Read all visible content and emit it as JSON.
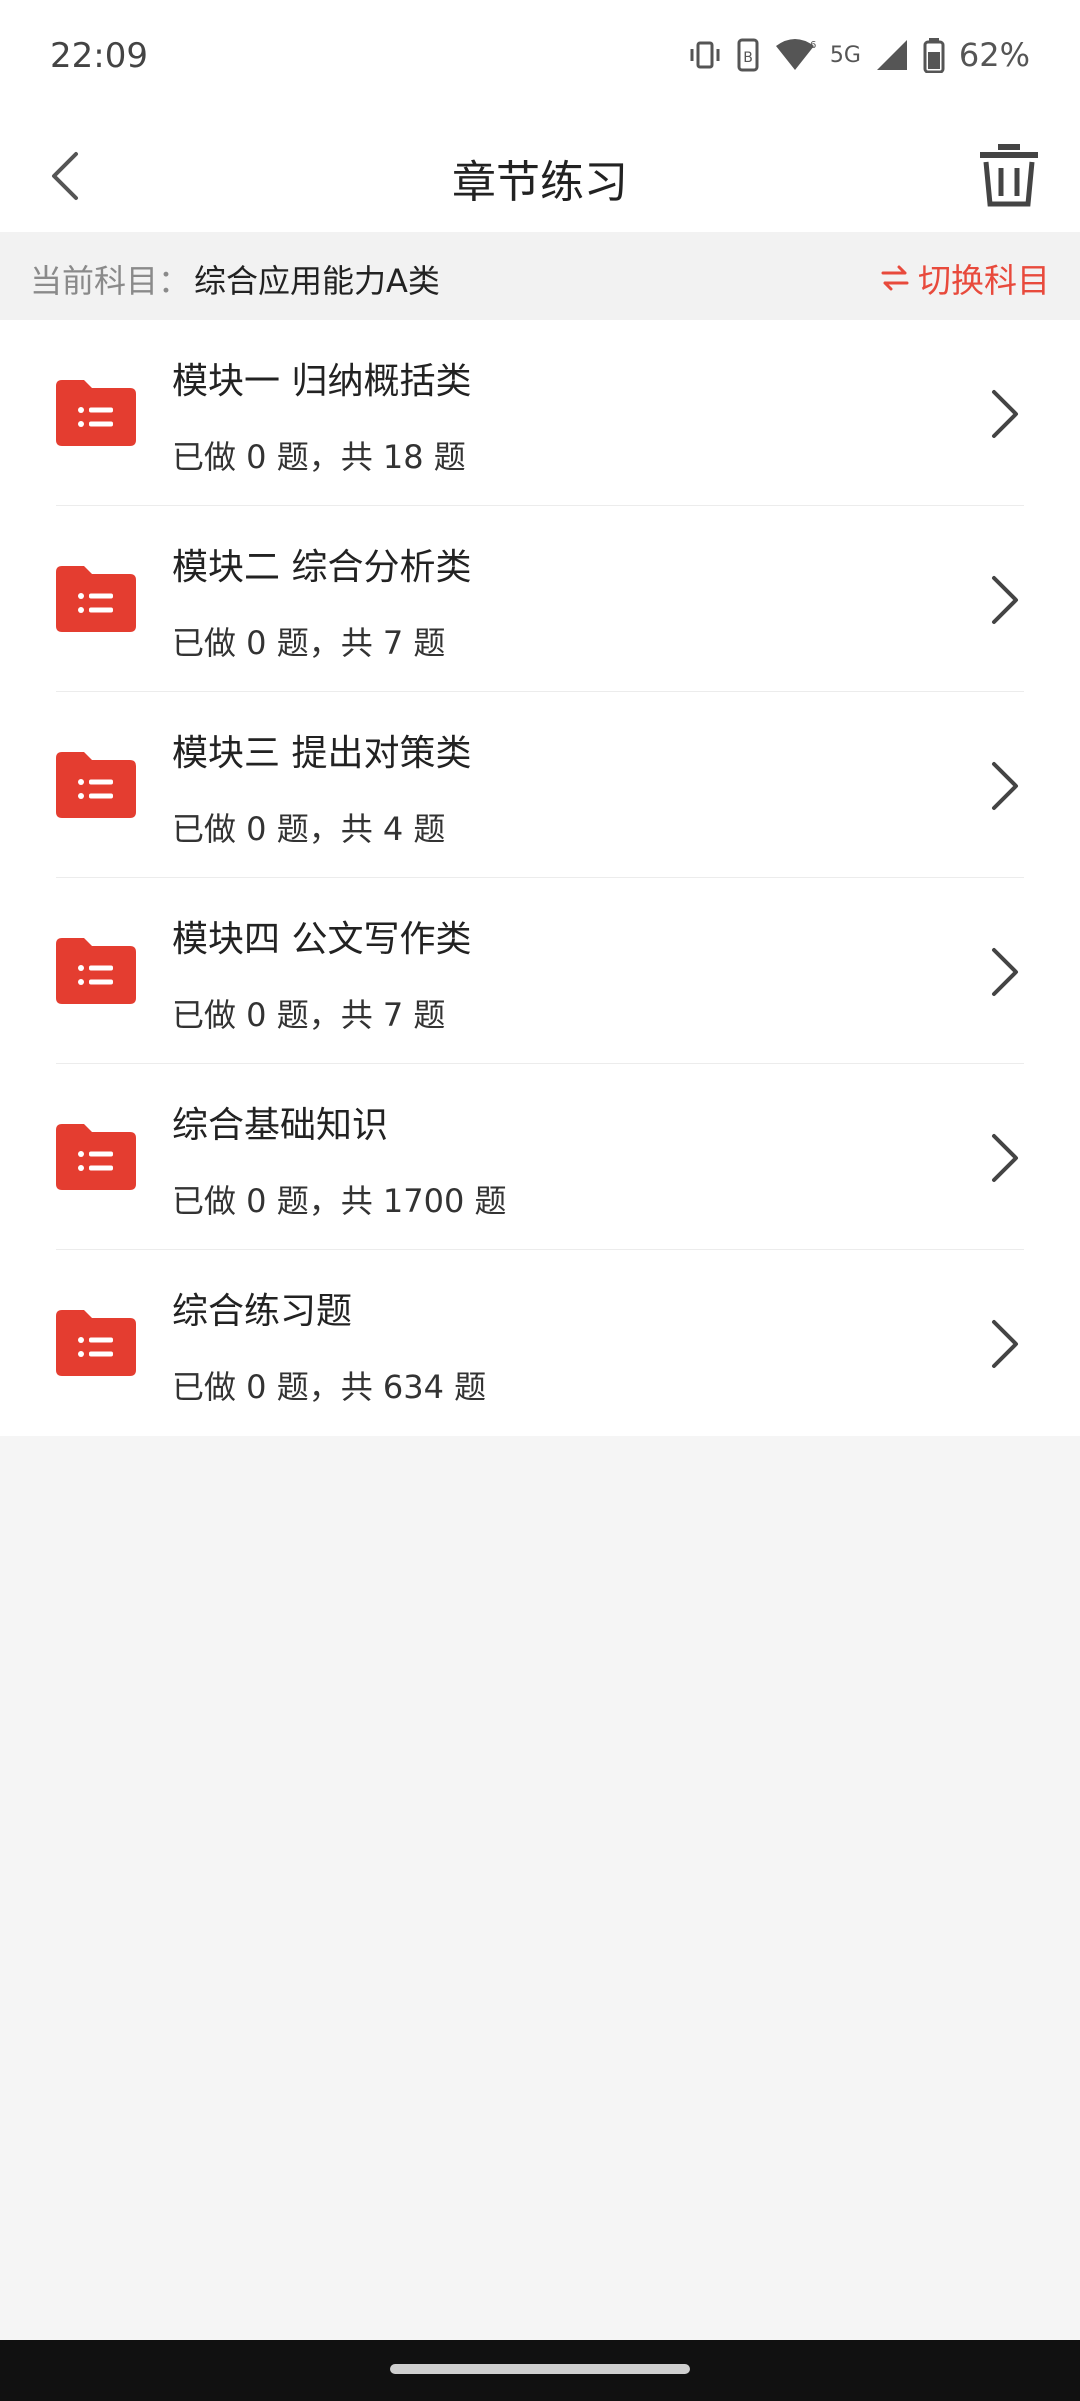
{
  "status_bar": {
    "time": "22:09",
    "network": "5G",
    "battery": "62%"
  },
  "header": {
    "title": "章节练习",
    "back_icon": "chevron-left-icon",
    "trash_icon": "trash-icon"
  },
  "subject": {
    "label": "当前科目：",
    "value": "综合应用能力A类",
    "switch_label": "切换科目",
    "accent_color": "#e84a3c"
  },
  "chapters": [
    {
      "name": "模块一 归纳概括类",
      "progress": "已做 0 题，共 18 题"
    },
    {
      "name": "模块二 综合分析类",
      "progress": "已做 0 题，共 7 题"
    },
    {
      "name": "模块三 提出对策类",
      "progress": "已做 0 题，共 4 题"
    },
    {
      "name": "模块四 公文写作类",
      "progress": "已做 0 题，共 7 题"
    },
    {
      "name": "综合基础知识",
      "progress": "已做 0 题，共 1700 题"
    },
    {
      "name": "综合练习题",
      "progress": "已做 0 题，共 634 题"
    }
  ]
}
